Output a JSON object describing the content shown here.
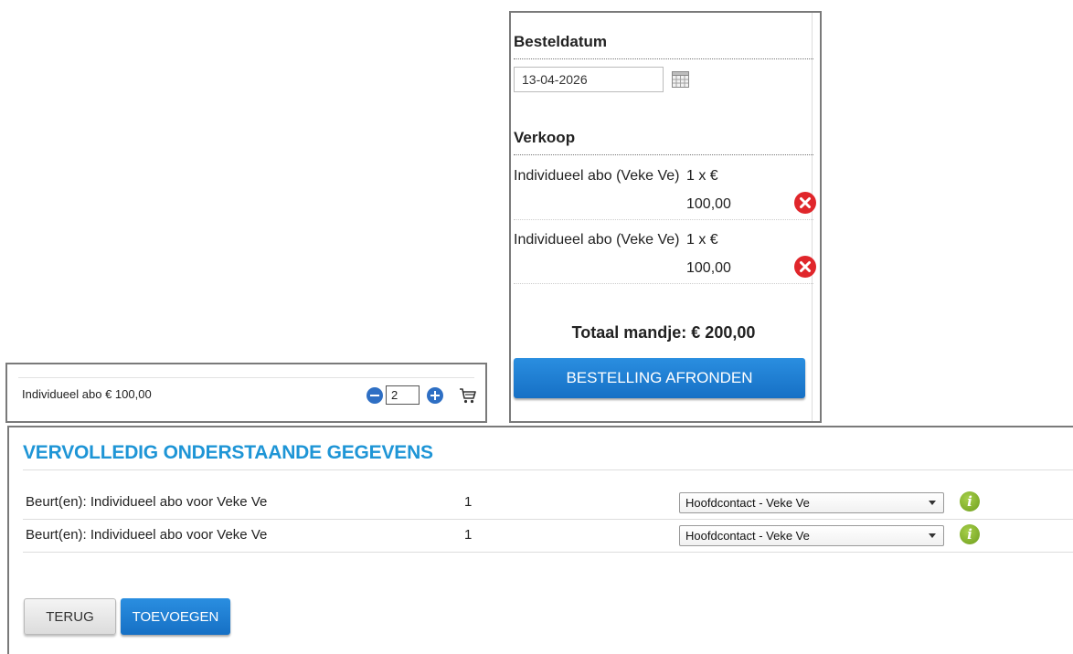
{
  "cart": {
    "date_heading": "Besteldatum",
    "date_value": "13-04-2026",
    "sale_heading": "Verkoop",
    "lines": [
      {
        "desc": "Individueel abo (Veke Ve)",
        "qty": "1 x €",
        "price": "100,00"
      },
      {
        "desc": "Individueel abo (Veke Ve)",
        "qty": "1 x €",
        "price": "100,00"
      }
    ],
    "total": "Totaal mandje: € 200,00",
    "checkout_label": "BESTELLING AFRONDEN"
  },
  "product": {
    "name": "Individueel abo € 100,00",
    "quantity": "2"
  },
  "details": {
    "title": "VERVOLLEDIG ONDERSTAANDE GEGEVENS",
    "rows": [
      {
        "label": "Beurt(en): Individueel abo voor Veke Ve",
        "count": "1",
        "contact": "Hoofdcontact - Veke Ve"
      },
      {
        "label": "Beurt(en): Individueel abo voor Veke Ve",
        "count": "1",
        "contact": "Hoofdcontact - Veke Ve"
      }
    ],
    "back_label": "TERUG",
    "add_label": "TOEVOEGEN"
  },
  "icons": {
    "calendar": "calendar-icon",
    "delete": "delete-icon",
    "minus": "minus-icon",
    "plus": "plus-icon",
    "cart": "shopping-cart-icon",
    "info": "info-icon"
  },
  "colors": {
    "accent_blue": "#1e95d6",
    "button_blue": "#1670c5",
    "delete_red": "#e0262b",
    "info_green": "#7fae2a"
  }
}
